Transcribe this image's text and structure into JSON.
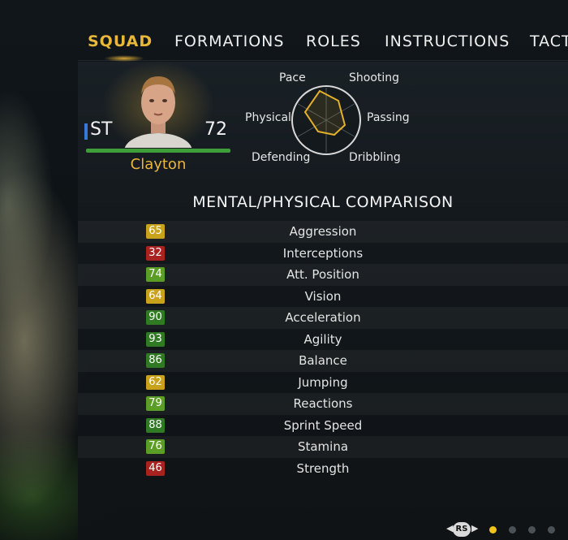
{
  "tabs": [
    {
      "label": "SQUAD",
      "active": true
    },
    {
      "label": "FORMATIONS",
      "active": false
    },
    {
      "label": "ROLES",
      "active": false
    },
    {
      "label": "INSTRUCTIONS",
      "active": false
    },
    {
      "label": "TACT",
      "active": false
    }
  ],
  "player": {
    "position": "ST",
    "rating": "72",
    "name": "Clayton"
  },
  "radar": {
    "labels": {
      "pace": "Pace",
      "shooting": "Shooting",
      "passing": "Passing",
      "dribbling": "Dribbling",
      "defending": "Defending",
      "physical": "Physical"
    }
  },
  "comparison": {
    "title": "MENTAL/PHYSICAL COMPARISON",
    "colors": {
      "yellow": "#c9a21c",
      "red": "#a82220",
      "lightgreen": "#5a9e26",
      "green": "#2f7a22"
    },
    "rows": [
      {
        "value": "65",
        "label": "Aggression",
        "color": "#c9a21c"
      },
      {
        "value": "32",
        "label": "Interceptions",
        "color": "#a82220"
      },
      {
        "value": "74",
        "label": "Att. Position",
        "color": "#5a9e26"
      },
      {
        "value": "64",
        "label": "Vision",
        "color": "#c9a21c"
      },
      {
        "value": "90",
        "label": "Acceleration",
        "color": "#2f7a22"
      },
      {
        "value": "93",
        "label": "Agility",
        "color": "#2f7a22"
      },
      {
        "value": "86",
        "label": "Balance",
        "color": "#2f7a22"
      },
      {
        "value": "62",
        "label": "Jumping",
        "color": "#c9a21c"
      },
      {
        "value": "79",
        "label": "Reactions",
        "color": "#5a9e26"
      },
      {
        "value": "88",
        "label": "Sprint Speed",
        "color": "#2f7a22"
      },
      {
        "value": "76",
        "label": "Stamina",
        "color": "#5a9e26"
      },
      {
        "value": "46",
        "label": "Strength",
        "color": "#a82220"
      }
    ]
  },
  "pager": {
    "button": "RS",
    "pages": 4,
    "current": 1
  }
}
